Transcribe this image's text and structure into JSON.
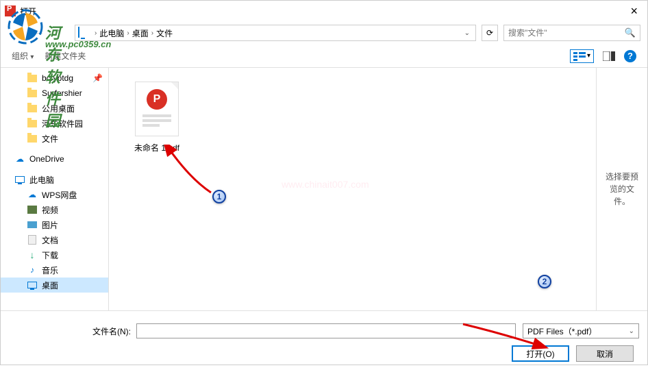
{
  "watermark": {
    "brand": "河东软件园",
    "url": "www.pc0359.cn",
    "center": "www.chinait007.com"
  },
  "title_bar": {
    "title": "打开",
    "close": "×"
  },
  "nav": {
    "breadcrumb": [
      "此电脑",
      "桌面",
      "文件"
    ],
    "search_placeholder": "搜索\"文件\""
  },
  "toolbar": {
    "organize": "组织",
    "new_folder": "新建文件夹"
  },
  "sidebar": {
    "items": [
      {
        "label": "bcryptdg",
        "icon": "folder",
        "pin": true
      },
      {
        "label": "Surfershier",
        "icon": "folder"
      },
      {
        "label": "公用桌面",
        "icon": "folder"
      },
      {
        "label": "河东软件园",
        "icon": "folder"
      },
      {
        "label": "文件",
        "icon": "folder"
      },
      {
        "label": "OneDrive",
        "icon": "onedrive",
        "group": true
      },
      {
        "label": "此电脑",
        "icon": "computer",
        "group": true
      },
      {
        "label": "WPS网盘",
        "icon": "disk",
        "indent": true
      },
      {
        "label": "视频",
        "icon": "media",
        "indent": true
      },
      {
        "label": "图片",
        "icon": "image",
        "indent": true
      },
      {
        "label": "文档",
        "icon": "doc",
        "indent": true
      },
      {
        "label": "下载",
        "icon": "download",
        "indent": true
      },
      {
        "label": "音乐",
        "icon": "music",
        "indent": true
      },
      {
        "label": "桌面",
        "icon": "computer",
        "indent": true,
        "selected": true
      }
    ]
  },
  "files": {
    "item0": {
      "name": "未命名 1.pdf"
    }
  },
  "preview": {
    "empty": "选择要预览的文件。"
  },
  "footer": {
    "filename_label": "文件名(N):",
    "filename_value": "",
    "filter_label": "PDF Files（*.pdf）",
    "open": "打开(O)",
    "cancel": "取消"
  },
  "callouts": {
    "one": "1",
    "two": "2"
  }
}
